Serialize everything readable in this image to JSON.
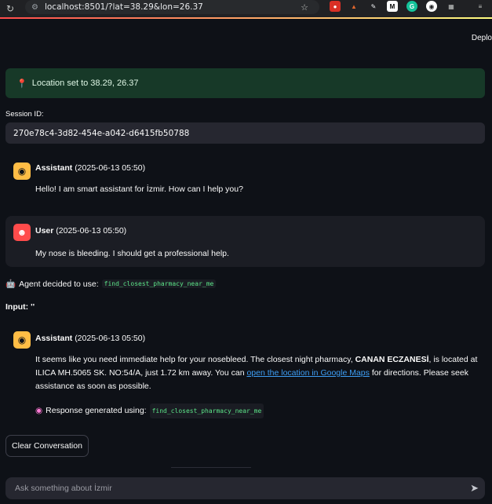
{
  "browser": {
    "url": "localhost:8501/?lat=38.29&lon=26.37",
    "extensions": [
      "shield-ext",
      "fox-ext",
      "pen-ext",
      "M",
      "G",
      "chrome-ext",
      "puzzle-icon",
      "cast-icon"
    ]
  },
  "header": {
    "deploy_label": "Deplo"
  },
  "location_alert": {
    "icon": "pin-icon",
    "text": "Location set to 38.29, 26.37"
  },
  "session": {
    "label": "Session ID:",
    "value": "270e78c4-3d82-454e-a042-d6415fb50788"
  },
  "messages": [
    {
      "role": "Assistant",
      "timestamp": "(2025-06-13 05:50)",
      "text": "Hello! I am smart assistant for İzmir. How can I help you?"
    },
    {
      "role": "User",
      "timestamp": "(2025-06-13 05:50)",
      "text": "My nose is bleeding. I should get a professional help."
    },
    {
      "role": "Assistant",
      "timestamp": "(2025-06-13 05:50)",
      "text_a": "It seems like you need immediate help for your nosebleed. The closest night pharmacy, ",
      "pharmacy": "CANAN ECZANESİ",
      "text_b": ", is located at ILICA MH.5065 SK. NO:54/A, just 1.72 km away. You can ",
      "link": "open the location in Google Maps",
      "text_c": " for directions. Please seek assistance as soon as possible.",
      "response_label": "Response generated using:",
      "tool": "find_closest_pharmacy_near_me"
    }
  ],
  "agent": {
    "label": "Agent decided to use:",
    "tool": "find_closest_pharmacy_near_me"
  },
  "input_label": "Input: ''",
  "clear_button": "Clear Conversation",
  "chat_input": {
    "placeholder": "Ask something about İzmir"
  }
}
